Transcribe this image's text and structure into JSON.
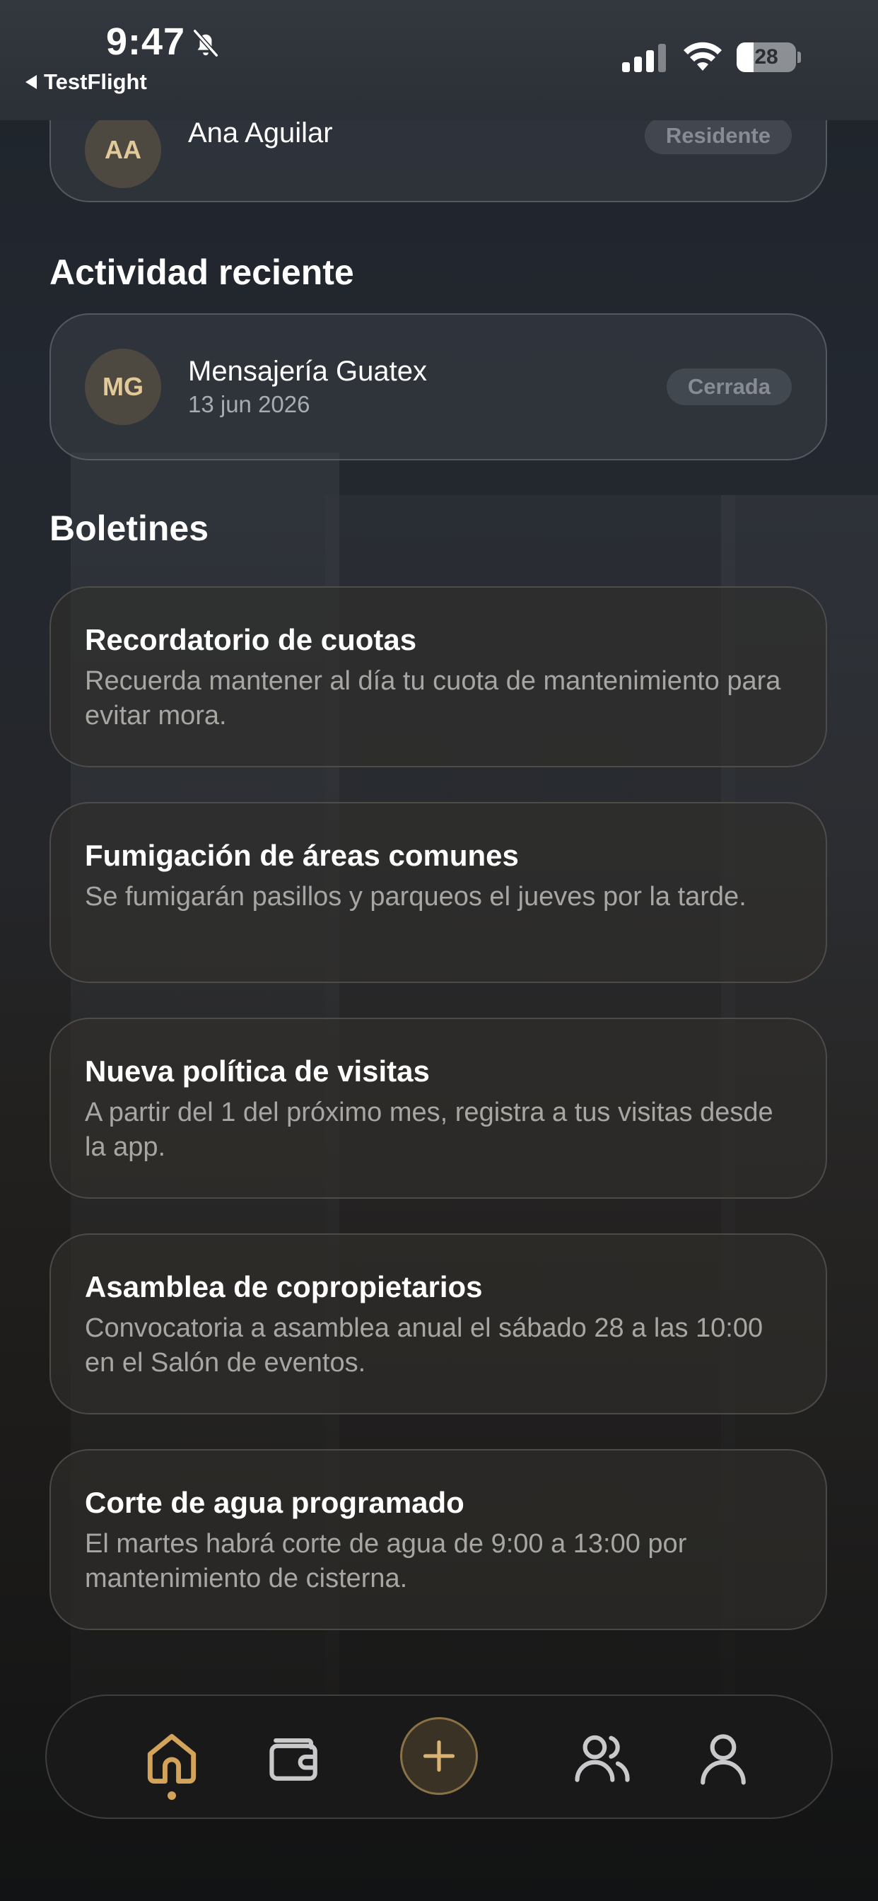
{
  "status_bar": {
    "time": "9:47",
    "back_label": "TestFlight",
    "battery_level": "28",
    "battery_fraction": 0.28
  },
  "members_card": {
    "avatar_initials": "AA",
    "name": "Ana Aguilar",
    "role": "Residente"
  },
  "recent_activity": {
    "title": "Actividad reciente",
    "item": {
      "avatar_initials": "MG",
      "name": "Mensajería Guatex",
      "date": "13 jun 2026",
      "status": "Cerrada"
    }
  },
  "bulletins": {
    "title": "Boletines",
    "items": [
      {
        "title": "Recordatorio de cuotas",
        "body": "Recuerda mantener al día tu cuota de mantenimiento para evitar mora."
      },
      {
        "title": "Fumigación de áreas comunes",
        "body": "Se fumigarán pasillos y parqueos el jueves por la tarde."
      },
      {
        "title": "Nueva política de visitas",
        "body": "A partir del 1 del próximo mes, registra a tus visitas desde la app."
      },
      {
        "title": "Asamblea de copropietarios",
        "body": "Convocatoria a asamblea anual el sábado 28 a las 10:00 en el Salón de eventos."
      },
      {
        "title": "Corte de agua programado",
        "body": "El martes habrá corte de agua de 9:00 a 13:00 por mantenimiento de cisterna."
      }
    ]
  },
  "tab_bar": {
    "tabs": [
      "home-icon",
      "wallet-icon",
      "plus-icon",
      "users-icon",
      "user-icon"
    ],
    "active": "home-icon",
    "accent_color": "#d3a35a"
  }
}
